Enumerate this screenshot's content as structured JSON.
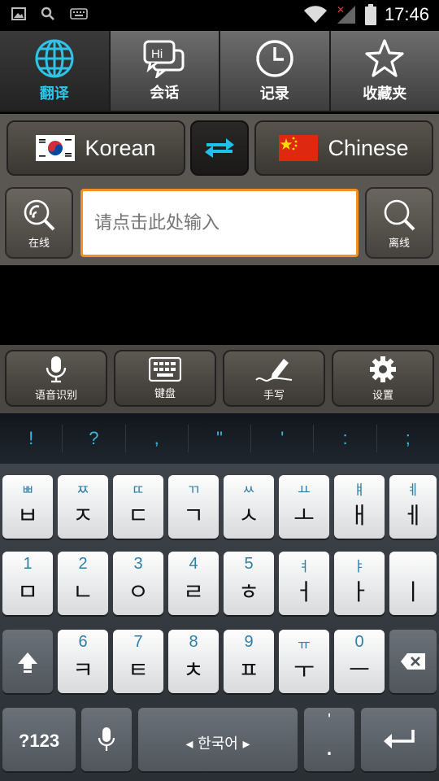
{
  "status_bar": {
    "time": "17:46"
  },
  "tabs": [
    {
      "label": "翻译",
      "icon": "globe-icon",
      "active": true
    },
    {
      "label": "会话",
      "icon": "chat-bubble-icon",
      "badge": "Hi",
      "active": false
    },
    {
      "label": "记录",
      "icon": "clock-icon",
      "active": false
    },
    {
      "label": "收藏夹",
      "icon": "star-icon",
      "active": false
    }
  ],
  "language": {
    "source": {
      "label": "Korean",
      "flag": "south-korea-flag-icon"
    },
    "target": {
      "label": "Chinese",
      "flag": "china-flag-icon"
    },
    "swap_icon": "swap-arrows-icon"
  },
  "search": {
    "online_label": "在线",
    "offline_label": "离线",
    "placeholder": "请点击此处输入",
    "value": ""
  },
  "input_modes": [
    {
      "label": "语音识别",
      "icon": "microphone-icon"
    },
    {
      "label": "键盘",
      "icon": "keyboard-icon"
    },
    {
      "label": "手写",
      "icon": "pen-icon"
    },
    {
      "label": "设置",
      "icon": "gear-icon"
    }
  ],
  "suggestions": [
    "!",
    "?",
    ",",
    "\"",
    "'",
    ":",
    ";"
  ],
  "keyboard": {
    "row1": [
      {
        "hint": "ㅃ",
        "main": "ㅂ"
      },
      {
        "hint": "ㅉ",
        "main": "ㅈ"
      },
      {
        "hint": "ㄸ",
        "main": "ㄷ"
      },
      {
        "hint": "ㄲ",
        "main": "ㄱ"
      },
      {
        "hint": "ㅆ",
        "main": "ㅅ"
      },
      {
        "hint": "ㅛ",
        "main": "ㅗ"
      },
      {
        "hint": "ㅒ",
        "main": "ㅐ"
      },
      {
        "hint": "ㅖ",
        "main": "ㅔ"
      }
    ],
    "row2": [
      {
        "hint": "1",
        "main": "ㅁ"
      },
      {
        "hint": "2",
        "main": "ㄴ"
      },
      {
        "hint": "3",
        "main": "ㅇ"
      },
      {
        "hint": "4",
        "main": "ㄹ"
      },
      {
        "hint": "5",
        "main": "ㅎ"
      },
      {
        "hint": "ㅕ",
        "main": "ㅓ"
      },
      {
        "hint": "ㅑ",
        "main": "ㅏ"
      },
      {
        "hint": "",
        "main": "ㅣ"
      }
    ],
    "row3": [
      {
        "hint": "6",
        "main": "ㅋ"
      },
      {
        "hint": "7",
        "main": "ㅌ"
      },
      {
        "hint": "8",
        "main": "ㅊ"
      },
      {
        "hint": "9",
        "main": "ㅍ"
      },
      {
        "hint": "ㅠ",
        "main": "ㅜ"
      },
      {
        "hint": "0",
        "main": "ㅡ"
      }
    ],
    "numbers_label": "?123",
    "space_label": "◂ 한국어 ▸",
    "period_hint": "'",
    "period_main": "."
  },
  "colors": {
    "accent": "#2fc3e8",
    "input_border": "#f19220",
    "hint": "#2f7fa5"
  }
}
